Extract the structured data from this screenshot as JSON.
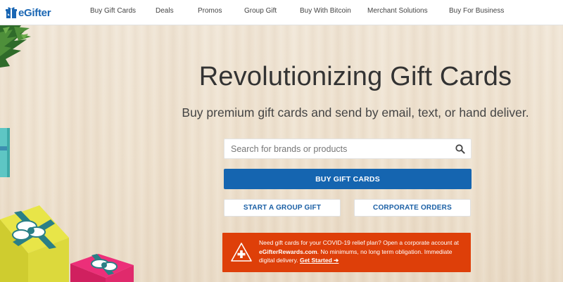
{
  "brand": {
    "logo_text": "eGifter"
  },
  "nav": {
    "items": [
      "Buy Gift Cards",
      "Deals",
      "Promos",
      "Group Gift",
      "Buy With Bitcoin",
      "Merchant Solutions",
      "Buy For Business"
    ]
  },
  "hero": {
    "title": "Revolutionizing Gift Cards",
    "subtitle": "Buy premium gift cards and send by email, text, or hand deliver."
  },
  "search": {
    "placeholder": "Search for brands or products",
    "value": ""
  },
  "buttons": {
    "buy": "BUY GIFT CARDS",
    "group": "START A GROUP GIFT",
    "corporate": "CORPORATE ORDERS"
  },
  "alert": {
    "line1": "Need gift cards for your COVID-19 relief plan? Open a corporate account at",
    "site": "eGifterRewards.com",
    "line2": ". No minimums, no long term obligation. Immediate digital delivery.",
    "cta": "Get Started",
    "cta_arrow": "➔"
  },
  "colors": {
    "brand_blue": "#1565b0",
    "alert_orange": "#de3f09",
    "logo_blue": "#1a66b3"
  },
  "icons": {
    "logo": "gift-box-icon",
    "search": "search-icon",
    "alert": "plus-cross-icon",
    "arrow": "arrow-right-icon"
  }
}
